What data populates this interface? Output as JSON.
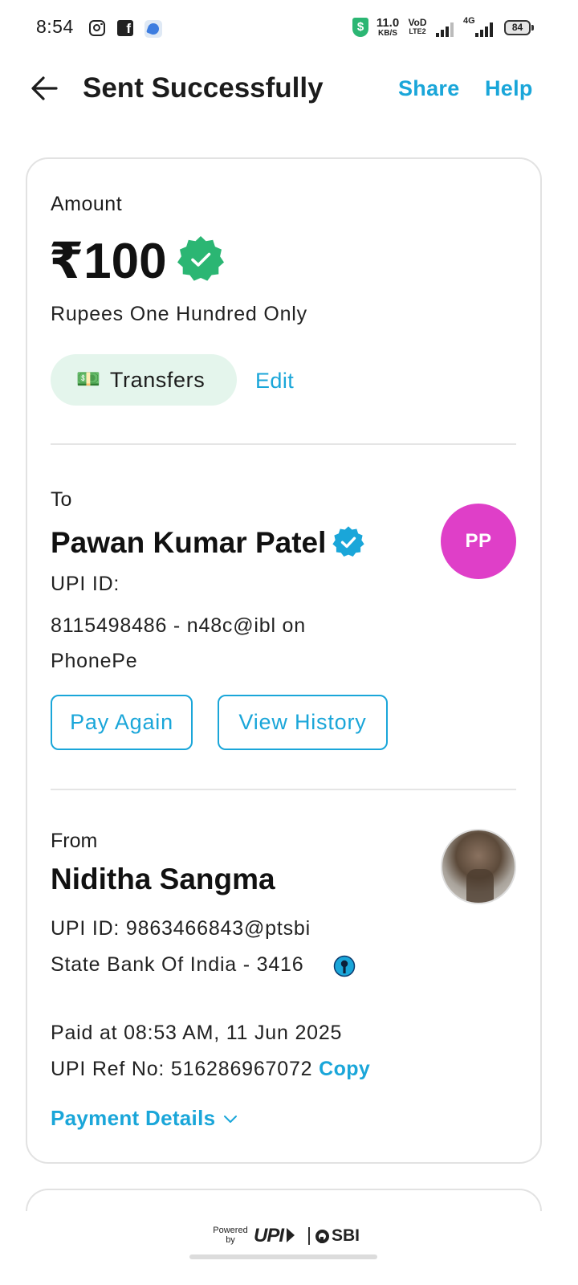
{
  "status_bar": {
    "time": "8:54",
    "net_speed_value": "11.0",
    "net_speed_unit": "KB/S",
    "volte_top": "VoD",
    "volte_bottom": "LTE2",
    "network_type": "4G",
    "battery": "84",
    "icons": [
      "instagram-icon",
      "facebook-icon",
      "app-icon",
      "shield-icon",
      "signal-icon",
      "battery-icon"
    ]
  },
  "header": {
    "title": "Sent Successfully",
    "share": "Share",
    "help": "Help"
  },
  "amount": {
    "label": "Amount",
    "value": "₹100",
    "words": "Rupees One Hundred Only",
    "category_icon": "💵",
    "category": "Transfers",
    "edit": "Edit"
  },
  "to": {
    "label": "To",
    "name": "Pawan Kumar Patel",
    "upi_label": "UPI ID:",
    "upi_id": "8115498486 - n48c@ibl on PhonePe",
    "initials": "PP",
    "pay_again": "Pay Again",
    "view_history": "View History"
  },
  "from": {
    "label": "From",
    "name": "Niditha Sangma",
    "upi": "UPI ID: 9863466843@ptsbi",
    "bank": "State Bank Of India - 3416"
  },
  "transaction": {
    "paid_at": "Paid at 08:53 AM, 11 Jun 2025",
    "ref_no": "UPI Ref No: 516286967072",
    "copy": "Copy",
    "payment_details": "Payment Details"
  },
  "footer": {
    "powered_by": "Powered by",
    "upi": "UPI",
    "sbi": "SBI"
  },
  "colors": {
    "accent": "#1aa6d9",
    "success": "#2bb673",
    "avatar": "#df3fc8",
    "chip_bg": "#e4f5ec"
  }
}
